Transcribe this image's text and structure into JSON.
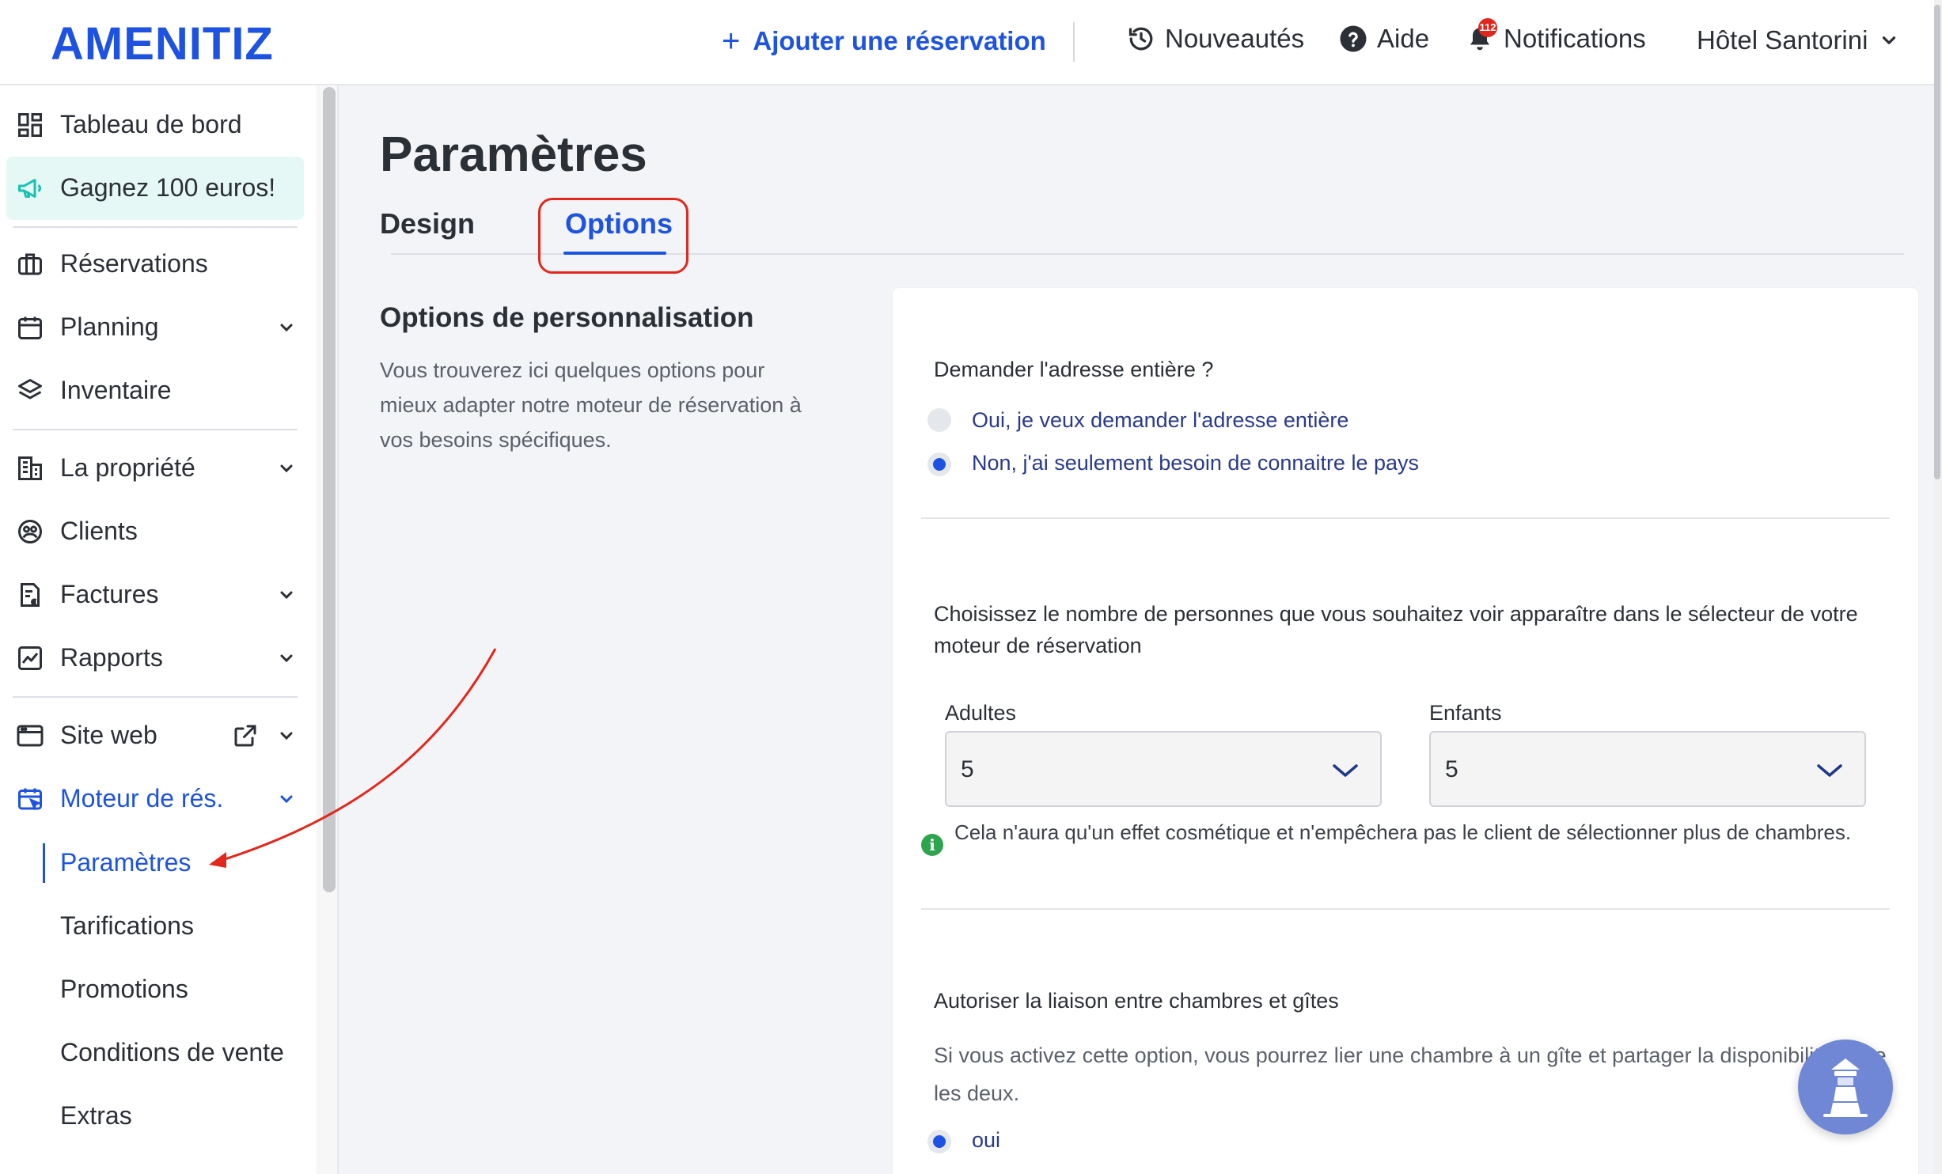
{
  "header": {
    "logo": "AMENITIZ",
    "add_reservation": "Ajouter une réservation",
    "news": "Nouveautés",
    "help": "Aide",
    "notifications": "Notifications",
    "notifications_count": "112",
    "hotel": "Hôtel Santorini"
  },
  "sidebar": {
    "dashboard": "Tableau de bord",
    "promo": "Gagnez 100 euros!",
    "reservations": "Réservations",
    "planning": "Planning",
    "inventory": "Inventaire",
    "property": "La propriété",
    "clients": "Clients",
    "invoices": "Factures",
    "reports": "Rapports",
    "website": "Site web",
    "booking_engine": "Moteur de rés.",
    "sub": {
      "settings": "Paramètres",
      "pricing": "Tarifications",
      "promotions": "Promotions",
      "terms": "Conditions de vente",
      "extras": "Extras"
    }
  },
  "main": {
    "title": "Paramètres",
    "tabs": [
      {
        "label": "Design"
      },
      {
        "label": "Options"
      }
    ],
    "section_title": "Options de personnalisation",
    "section_desc": "Vous trouverez ici quelques options pour mieux adapter notre moteur de réservation à vos besoins spécifiques.",
    "address_question": "Demander l'adresse entière ?",
    "address_options": [
      {
        "label": "Oui, je veux demander l'adresse entière",
        "selected": false
      },
      {
        "label": "Non, j'ai seulement besoin de connaitre le pays",
        "selected": true
      }
    ],
    "persons_question": "Choisissez le nombre de personnes que vous souhaitez voir apparaître dans le sélecteur de votre moteur de réservation",
    "adults_label": "Adultes",
    "adults_value": "5",
    "children_label": "Enfants",
    "children_value": "5",
    "info_note": "Cela n'aura qu'un effet cosmétique et n'empêchera pas le client de sélectionner plus de chambres.",
    "link_question": "Autoriser la liaison entre chambres et gîtes",
    "link_desc": "Si vous activez cette option, vous pourrez lier une chambre à un gîte et partager la disponibilité entre les deux.",
    "link_option_yes": "oui"
  },
  "colors": {
    "brand": "#1d53e0",
    "annotation": "#e2281c",
    "promo_bg": "#e5f8f6"
  }
}
